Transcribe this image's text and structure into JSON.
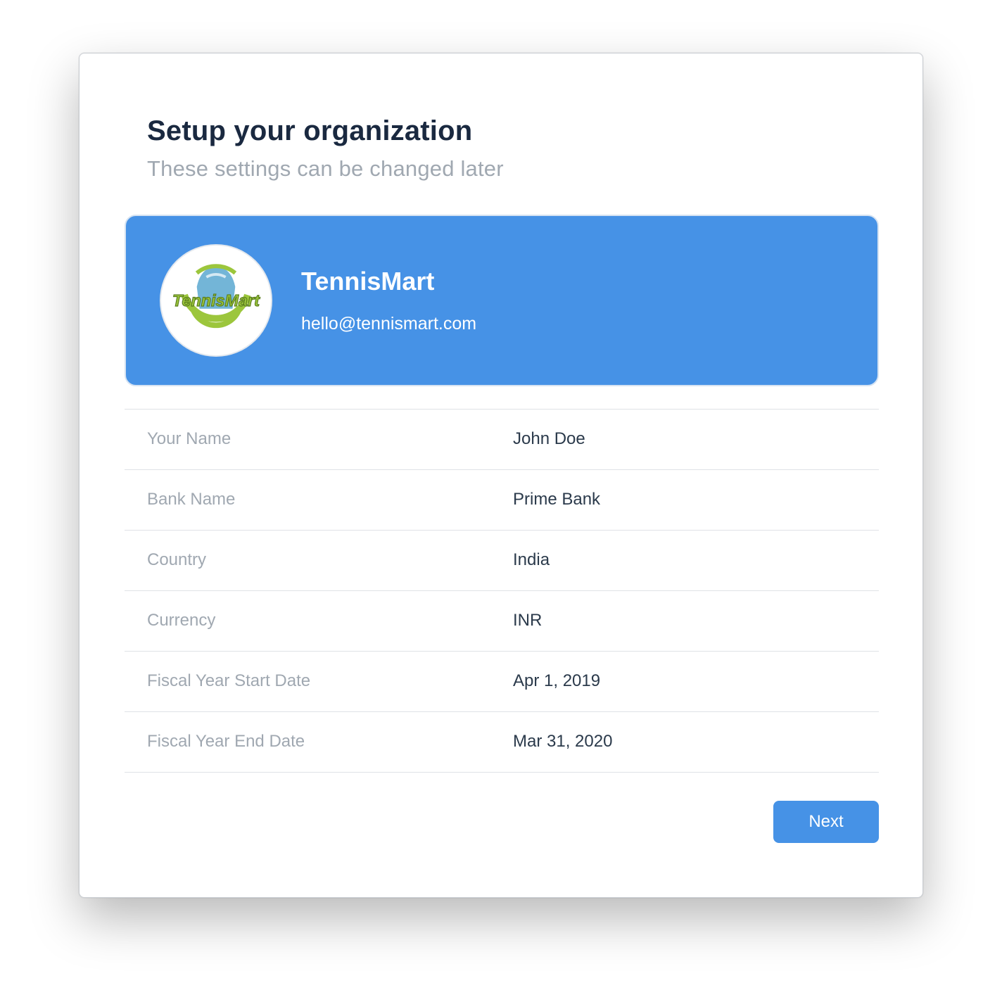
{
  "header": {
    "title": "Setup your organization",
    "subtitle": "These settings can be changed later"
  },
  "organization": {
    "name": "TennisMart",
    "email": "hello@tennismart.com",
    "logo_text": "TennisMart",
    "card_color": "#4692e6"
  },
  "fields": [
    {
      "label": "Your Name",
      "value": "John Doe"
    },
    {
      "label": "Bank Name",
      "value": "Prime Bank"
    },
    {
      "label": "Country",
      "value": "India"
    },
    {
      "label": "Currency",
      "value": "INR"
    },
    {
      "label": "Fiscal Year Start Date",
      "value": "Apr 1, 2019"
    },
    {
      "label": "Fiscal Year End Date",
      "value": "Mar 31, 2020"
    }
  ],
  "actions": {
    "next_label": "Next"
  },
  "colors": {
    "accent": "#4692e6",
    "title": "#1a2940",
    "muted": "#a0a8b1",
    "logo_green": "#9cc63c",
    "logo_blue": "#5aa8d0"
  }
}
